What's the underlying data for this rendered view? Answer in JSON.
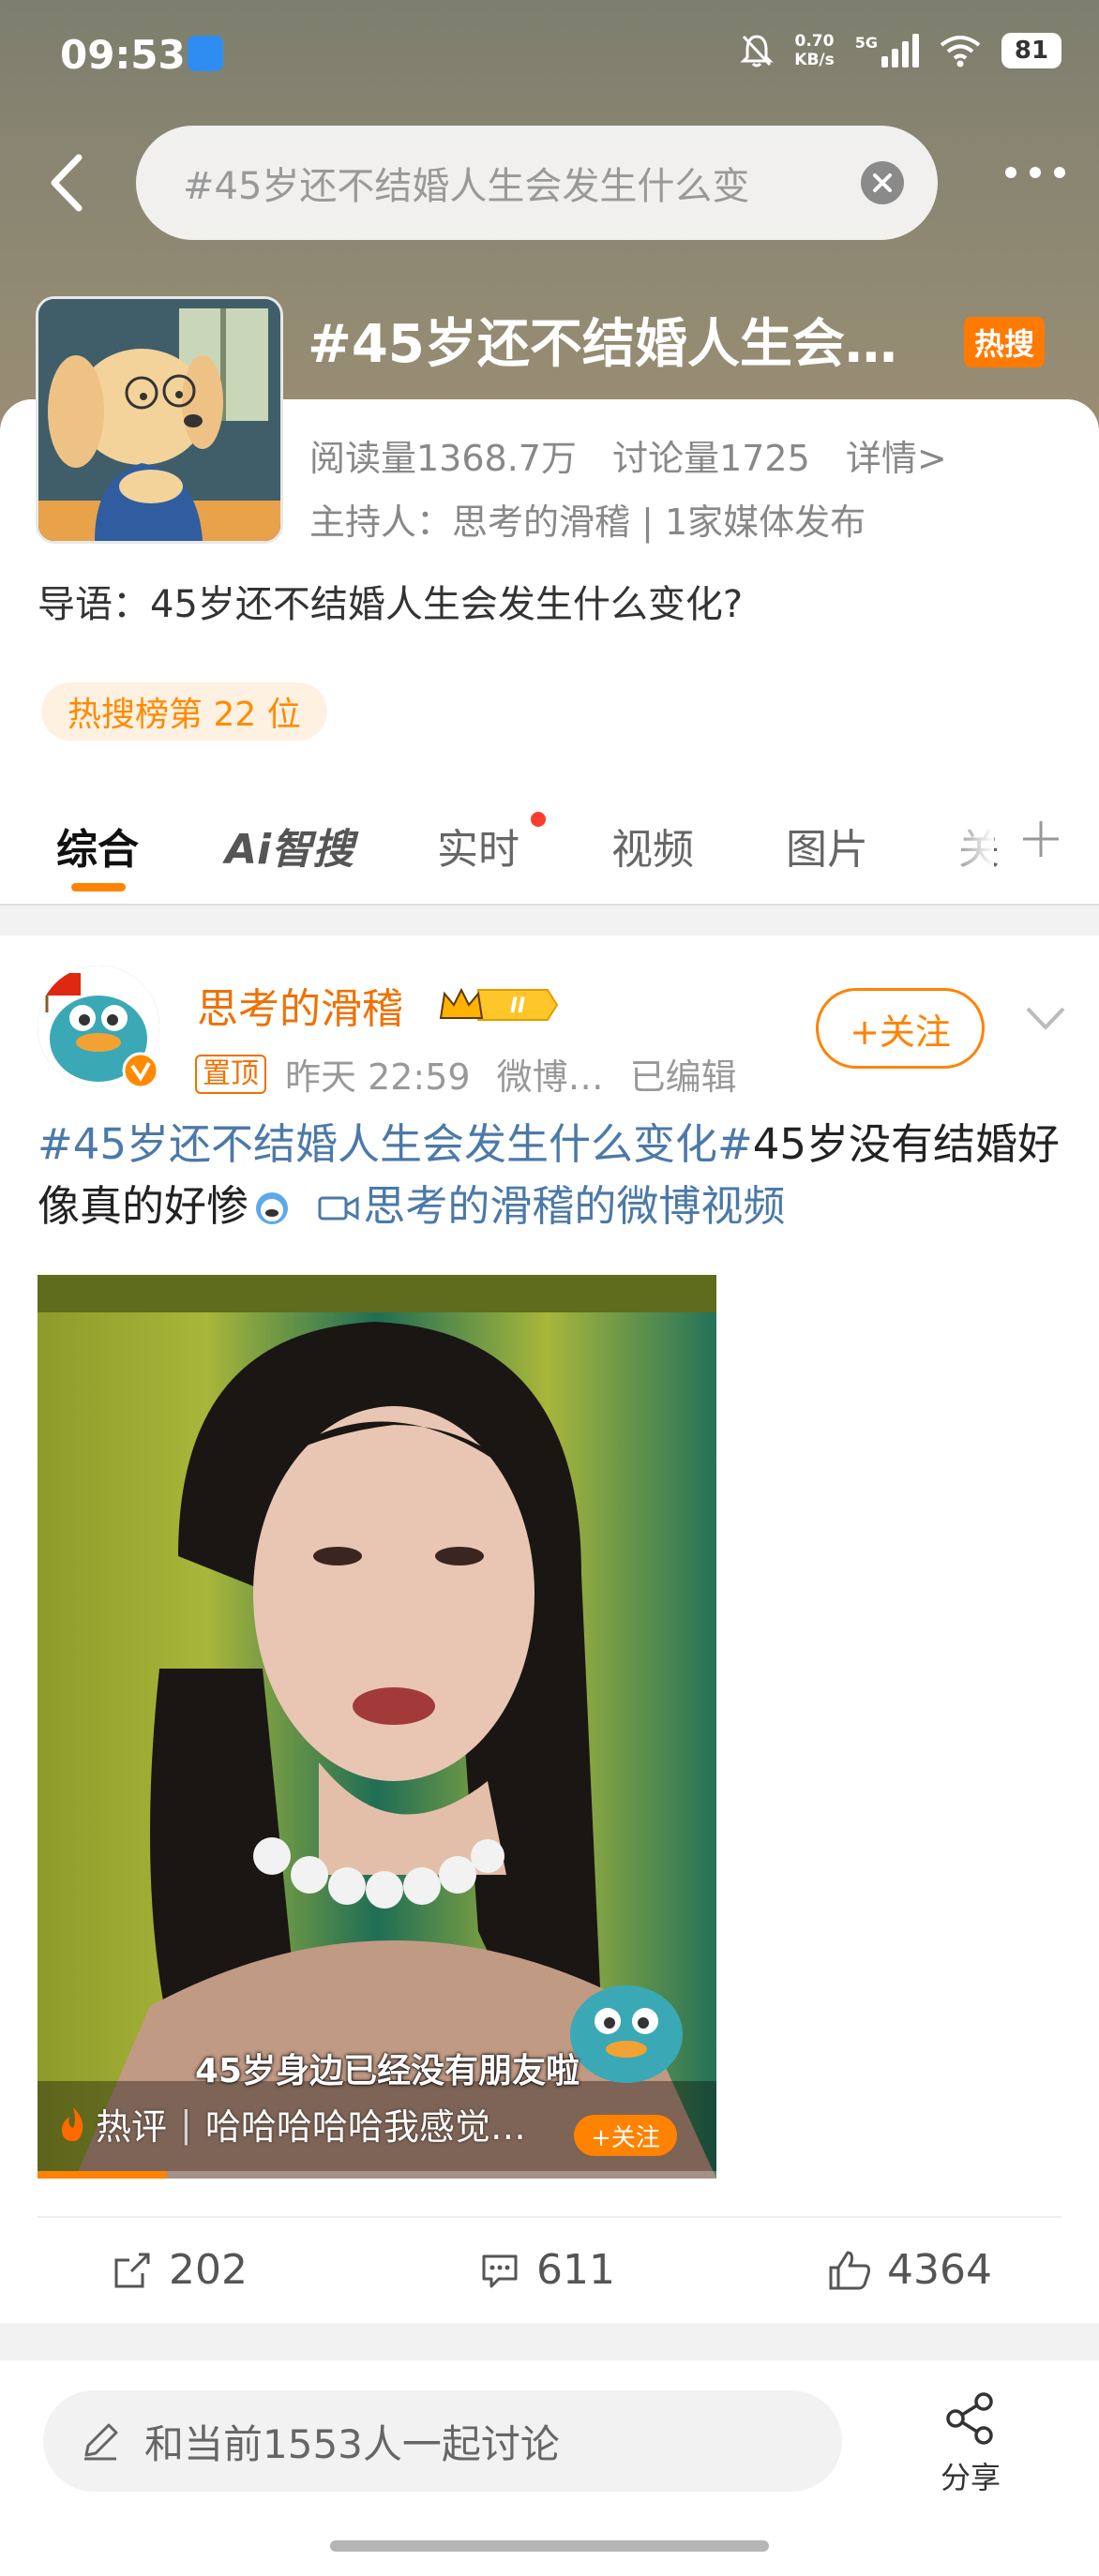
{
  "status_bar": {
    "time": "09:53",
    "net_speed_top": "0.70",
    "net_speed_bottom": "KB/s",
    "network_type": "5G",
    "battery": "81"
  },
  "search": {
    "query": "#45岁还不结婚人生会发生什么变"
  },
  "topic": {
    "title": "#45岁还不结婚人生会…",
    "hot_badge": "热搜",
    "reads": "阅读量1368.7万",
    "discussions": "讨论量1725",
    "details": "详情>",
    "host": "主持人：思考的滑稽 | 1家媒体发布",
    "intro": "导语：45岁还不结婚人生会发生什么变化?",
    "rank": "热搜榜第 22 位"
  },
  "tabs": [
    {
      "label": "综合"
    },
    {
      "label": "Ai智搜"
    },
    {
      "label": "实时"
    },
    {
      "label": "视频"
    },
    {
      "label": "图片"
    },
    {
      "label": "关"
    }
  ],
  "post": {
    "author": "思考的滑稽",
    "vip_level": "II",
    "pinned": "置顶",
    "time": "昨天 22:59",
    "source": "微博…",
    "edited": "已编辑",
    "follow": "+关注",
    "text_tag1": "#45岁还不结婚人生会发生什么变化#",
    "text_body": "45岁没有结婚好像真的好惨",
    "video_link": "思考的滑稽的微博视频",
    "video_subtitle": "45岁身边已经没有朋友啦",
    "hot_comment_label": "热评",
    "hot_comment_text": "哈哈哈哈哈我感觉…",
    "video_follow": "+关注",
    "video_progress": 0.19,
    "reposts": "202",
    "comments": "611",
    "likes": "4364"
  },
  "bottom": {
    "discuss_placeholder": "和当前1553人一起讨论",
    "share_label": "分享"
  },
  "colors": {
    "accent": "#ff8200",
    "hot_badge": "#ff7a00",
    "link": "#4b79a8",
    "author": "#f07000"
  }
}
